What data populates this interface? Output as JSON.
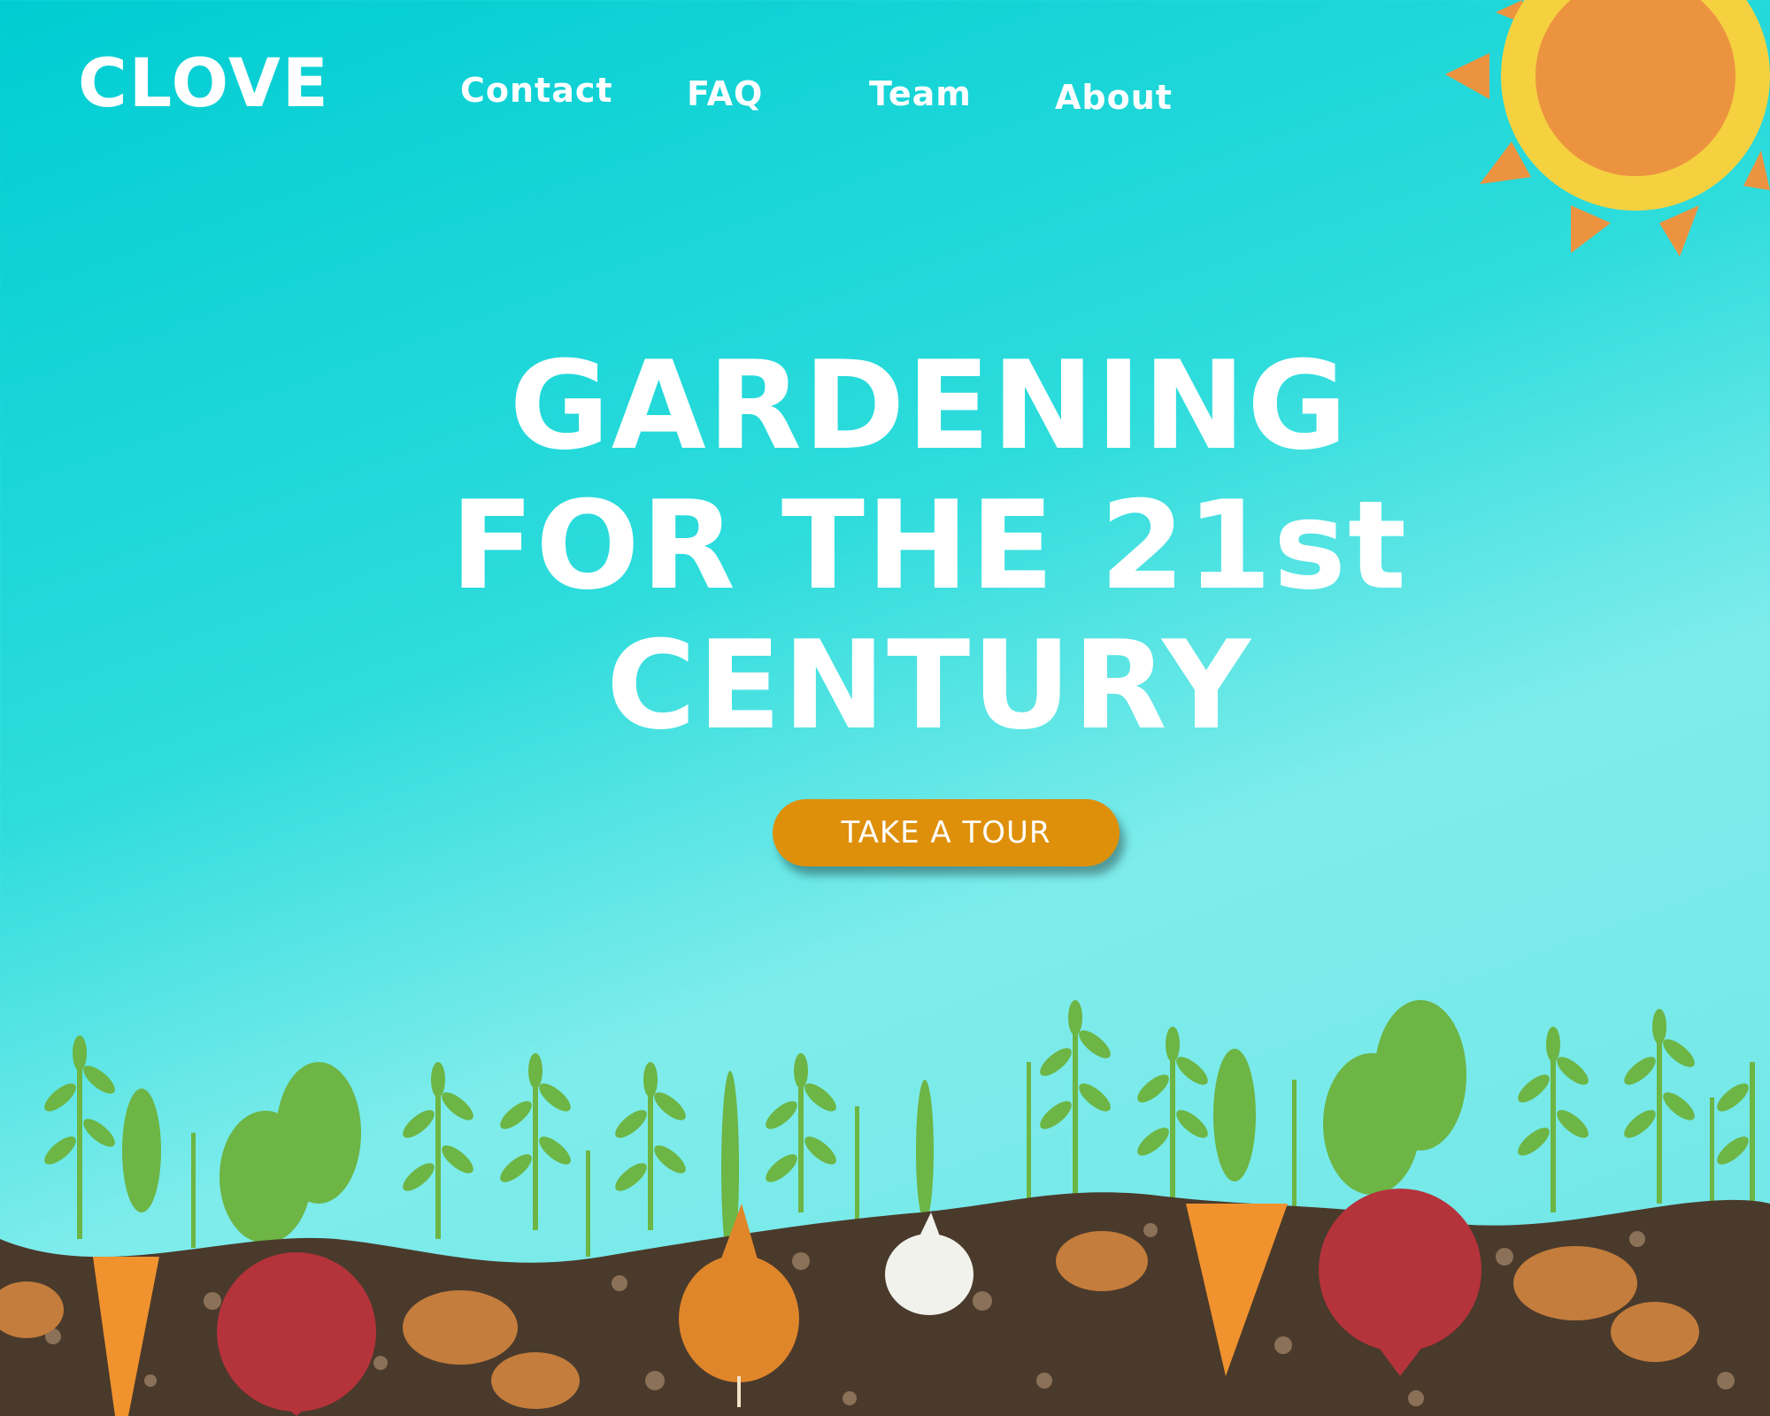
{
  "brand": {
    "logo_text": "CLOVE"
  },
  "nav": {
    "items": [
      "Contact",
      "FAQ",
      "Team",
      "About"
    ]
  },
  "hero": {
    "title_lines": [
      "GARDENING",
      "FOR THE 21st",
      "CENTURY"
    ],
    "cta_label": "TAKE A TOUR"
  },
  "colors": {
    "sky_top": "#00cdd2",
    "sky_bottom": "#7eeceb",
    "cta": "#de900b",
    "sun_outer": "#f5d140",
    "sun_inner": "#ec9340",
    "soil": "#4a3a2c",
    "leaf": "#6db544"
  }
}
